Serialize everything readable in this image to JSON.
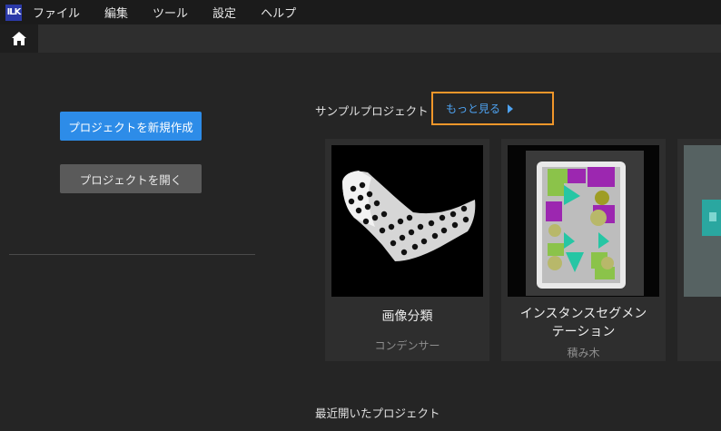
{
  "app": {
    "logo_text": "ILK",
    "menu": [
      "ファイル",
      "編集",
      "ツール",
      "設定",
      "ヘルプ"
    ]
  },
  "left": {
    "new_project_label": "プロジェクトを新規作成",
    "open_project_label": "プロジェクトを開く"
  },
  "samples": {
    "title": "サンプルプロジェクト",
    "more_label": "もっと見る",
    "cards": [
      {
        "title": "画像分類",
        "subtitle": "コンデンサー"
      },
      {
        "title_line1": "インスタンスセグメン",
        "title_line2": "テーション",
        "subtitle": "積み木"
      }
    ]
  },
  "recent": {
    "title": "最近開いたプロジェクト"
  },
  "colors": {
    "accent_blue": "#2d8ce8",
    "link_blue": "#4ea3f2",
    "highlight_orange": "#f0962a"
  }
}
